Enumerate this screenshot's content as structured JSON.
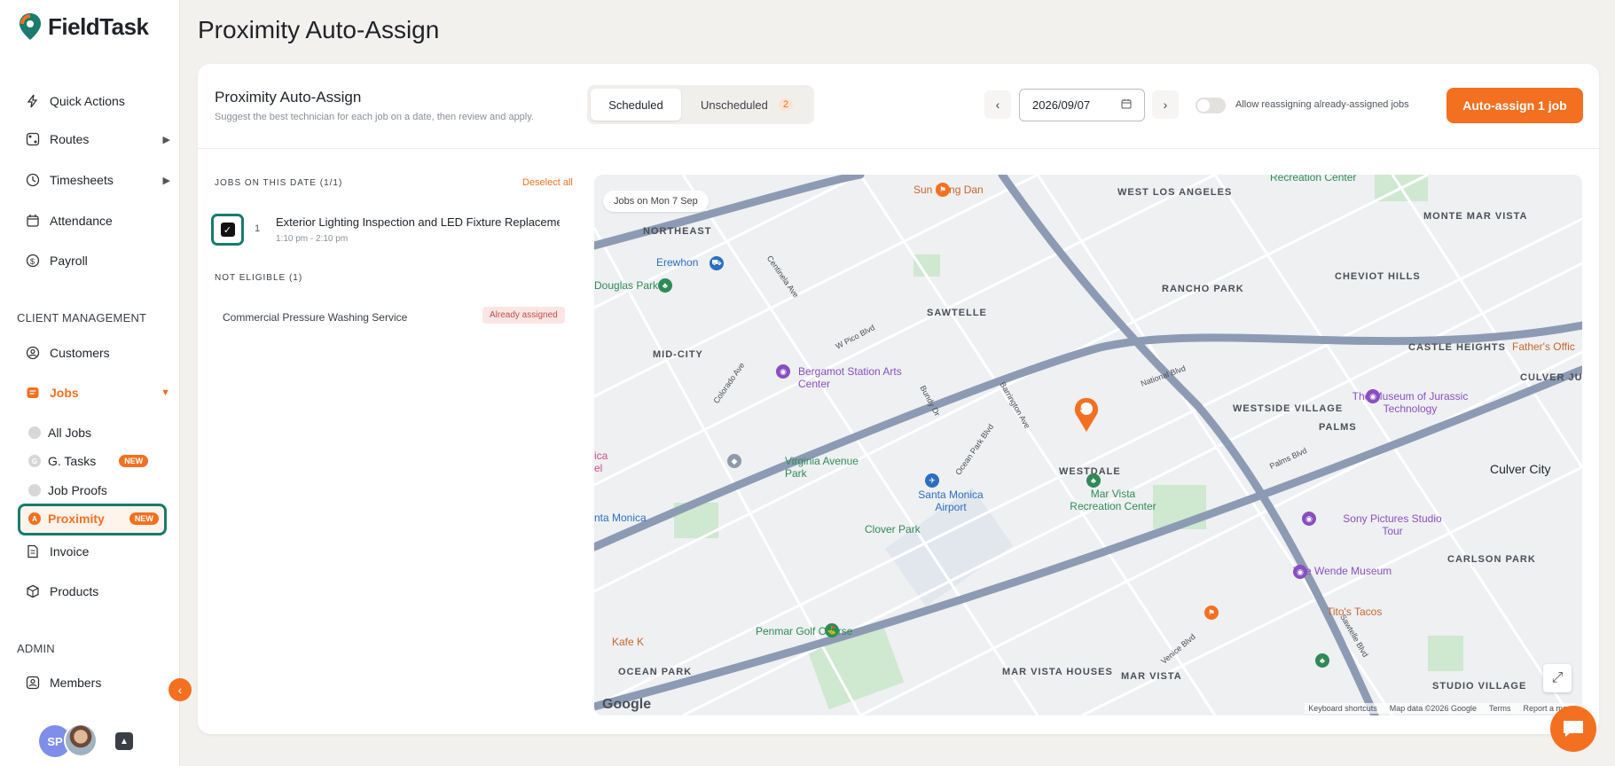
{
  "app": {
    "name": "FieldTask"
  },
  "page": {
    "title": "Proximity Auto-Assign"
  },
  "sidebar": {
    "items": [
      {
        "label": "Quick Actions",
        "icon": "bolt-icon"
      },
      {
        "label": "Routes",
        "icon": "route-icon",
        "expandable": true
      },
      {
        "label": "Timesheets",
        "icon": "clock-icon",
        "expandable": true
      },
      {
        "label": "Attendance",
        "icon": "calendar-icon"
      },
      {
        "label": "Payroll",
        "icon": "dollar-icon"
      }
    ],
    "client_section": "CLIENT MANAGEMENT",
    "client_items": [
      {
        "label": "Customers",
        "icon": "user-icon"
      },
      {
        "label": "Jobs",
        "icon": "jobs-icon",
        "expanded": true
      }
    ],
    "job_sub_items": [
      {
        "label": "All Jobs",
        "badge": ""
      },
      {
        "label": "G. Tasks",
        "badge": "NEW"
      },
      {
        "label": "Job Proofs",
        "badge": ""
      },
      {
        "label": "Proximity",
        "badge": "NEW",
        "active": true
      }
    ],
    "more_items": [
      {
        "label": "Invoice",
        "icon": "invoice-icon"
      },
      {
        "label": "Products",
        "icon": "box-icon"
      }
    ],
    "admin_section": "ADMIN",
    "admin_items": [
      {
        "label": "Members",
        "icon": "member-icon"
      }
    ],
    "user_initials": "SP"
  },
  "card": {
    "title": "Proximity Auto-Assign",
    "subtitle": "Suggest the best technician for each job on a date, then review and apply.",
    "tabs": [
      {
        "label": "Scheduled",
        "active": true
      },
      {
        "label": "Unscheduled",
        "count": "2"
      }
    ],
    "date": "2026/09/07",
    "toggle_label": "Allow reassigning already-assigned jobs",
    "toggle_on": false,
    "primary_action": "Auto-assign 1 job"
  },
  "jobs": {
    "header": "JOBS ON THIS DATE (1/1)",
    "deselect_label": "Deselect all",
    "items": [
      {
        "index": "1",
        "title": "Exterior Lighting Inspection and LED Fixture Replacement",
        "time": "1:10 pm - 2:10 pm",
        "checked": true
      }
    ],
    "not_eligible_header": "NOT ELIGIBLE (1)",
    "not_eligible": [
      {
        "title": "Commercial Pressure Washing Service",
        "status": "Already assigned"
      }
    ]
  },
  "map": {
    "chip": "Jobs on Mon 7 Sep",
    "marker_label": "1",
    "neighborhoods": [
      "NORTHEAST",
      "WEST LOS ANGELES",
      "MONTE MAR VISTA",
      "SAWTELLE",
      "RANCHO PARK",
      "CHEVIOT HILLS",
      "MID-CITY",
      "CASTLE HEIGHTS",
      "CULVER JUNCTION",
      "WESTSIDE VILLAGE",
      "PALMS",
      "WESTDALE",
      "OCEAN PARK",
      "MAR VISTA HOUSES",
      "MAR VISTA",
      "STUDIO VILLAGE",
      "CARLSON PARK"
    ],
    "places": [
      "Sun Nong Dan",
      "Recreation Center",
      "Erewhon",
      "Douglas Park",
      "Bergamot Station Arts Center",
      "Virginia Avenue Park",
      "Santa Monica Airport",
      "Clover Park",
      "Mar Vista Recreation Center",
      "The Museum of Jurassic Technology",
      "Culver City",
      "Sony Pictures Studio Tour",
      "The Wende Museum",
      "Tito's Tacos",
      "Penmar Golf Course",
      "Kafe K",
      "nta Monica",
      "ica",
      "el",
      "Father's Offic"
    ],
    "streets": [
      "W Pico Blvd",
      "Colorado Ave",
      "Ocean Park Blvd",
      "Venice Blvd",
      "National Blvd",
      "Palms Blvd",
      "Sawtelle Blvd",
      "Barrington Ave",
      "Bundy Dr",
      "Centinela Ave"
    ],
    "brand": "Google",
    "attribution": [
      "Keyboard shortcuts",
      "Map data ©2026 Google",
      "Terms",
      "Report a map"
    ]
  },
  "colors": {
    "accent": "#f37021",
    "highlight": "#1a7a6e",
    "road": "#8c9bb3"
  }
}
